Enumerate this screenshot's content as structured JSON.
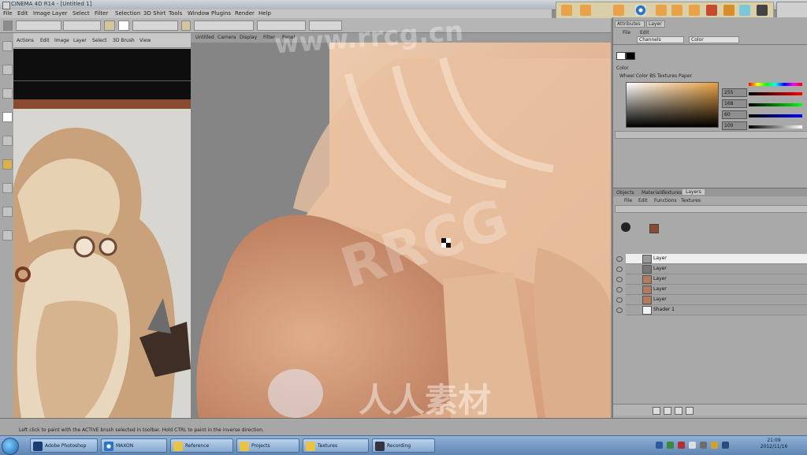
{
  "window": {
    "title": "CINEMA 4D R14 - [Untitled 1]"
  },
  "menubar": {
    "items": [
      "File",
      "Edit",
      "Image",
      "Layer",
      "Select",
      "Filter",
      "Selection",
      "3D Shirt",
      "Tools",
      "Window",
      "Plugins",
      "Render",
      "Help"
    ]
  },
  "reference_panel": {
    "menu": [
      "Actions",
      "Edit",
      "Image",
      "Layer",
      "Select",
      "3D Brush",
      "View"
    ]
  },
  "canvas": {
    "tabs": [
      "Untitled",
      "Camera",
      "Display",
      "Filter",
      "Panel"
    ]
  },
  "right_panel": {
    "top_tabs": [
      "Attributes",
      "Layer"
    ],
    "menu": [
      "File",
      "Edit"
    ],
    "dropdowns": [
      "Channels",
      "Color"
    ],
    "color_section_label": "Color",
    "color_tabs": "Wheel Color BS Textures Paper",
    "rgb_values": [
      "255",
      "168",
      "60",
      "100"
    ],
    "layer_tabs": [
      "Objects",
      "Materials",
      "Textures",
      "Layers"
    ],
    "layer_menu": [
      "File",
      "Edit",
      "Functions",
      "Textures"
    ],
    "layers": [
      {
        "name": "Layer",
        "selected": true
      },
      {
        "name": "Layer",
        "selected": false
      },
      {
        "name": "Layer",
        "selected": false
      },
      {
        "name": "Layer",
        "selected": false
      },
      {
        "name": "Layer",
        "selected": false
      },
      {
        "name": "Shader 1",
        "selected": false
      }
    ]
  },
  "statusbar": {
    "text": "Left click to paint with the ACTIVE brush selected in toolbar. Hold CTRL to paint in the inverse direction."
  },
  "taskbar": {
    "items": [
      "Adobe Photoshop",
      "MAXON",
      "Reference",
      "Projects",
      "Textures",
      "Recording"
    ],
    "clock_time": "21:09",
    "clock_date": "2012/11/16"
  },
  "watermarks": {
    "top": "www.rrcg.cn",
    "middle": "RRCG",
    "bottom": "人人素材"
  },
  "colors": {
    "ui_grey": "#a9a9a9",
    "skin_tone": "#d9a27c",
    "taskbar": "#6f93bf"
  }
}
